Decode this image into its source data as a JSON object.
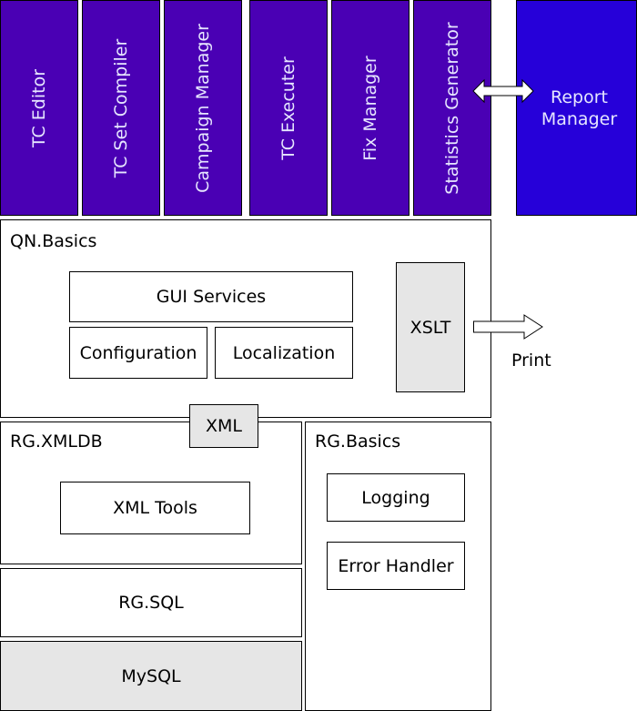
{
  "top_modules": [
    {
      "label": "TC Editor"
    },
    {
      "label": "TC Set Compiler"
    },
    {
      "label": "Campaign Manager"
    },
    {
      "label": "TC Executer"
    },
    {
      "label": "Fix Manager"
    },
    {
      "label": "Statistics Generator"
    }
  ],
  "report_manager": {
    "line1": "Report",
    "line2": "Manager"
  },
  "qn_basics": {
    "title": "QN.Basics",
    "gui_services": "GUI Services",
    "configuration": "Configuration",
    "localization": "Localization",
    "xslt": "XSLT"
  },
  "print_label": "Print",
  "xml_connector": "XML",
  "rg_xmldb": {
    "title": "RG.XMLDB",
    "xml_tools": "XML Tools"
  },
  "rg_sql": "RG.SQL",
  "mysql": "MySQL",
  "rg_basics": {
    "title": "RG.Basics",
    "logging": "Logging",
    "error_handler": "Error Handler"
  },
  "colors": {
    "module_purple": "#4a00b4",
    "report_blue": "#2600d9",
    "grey_fill": "#e6e6e6",
    "label_light": "#e6e6ff"
  }
}
